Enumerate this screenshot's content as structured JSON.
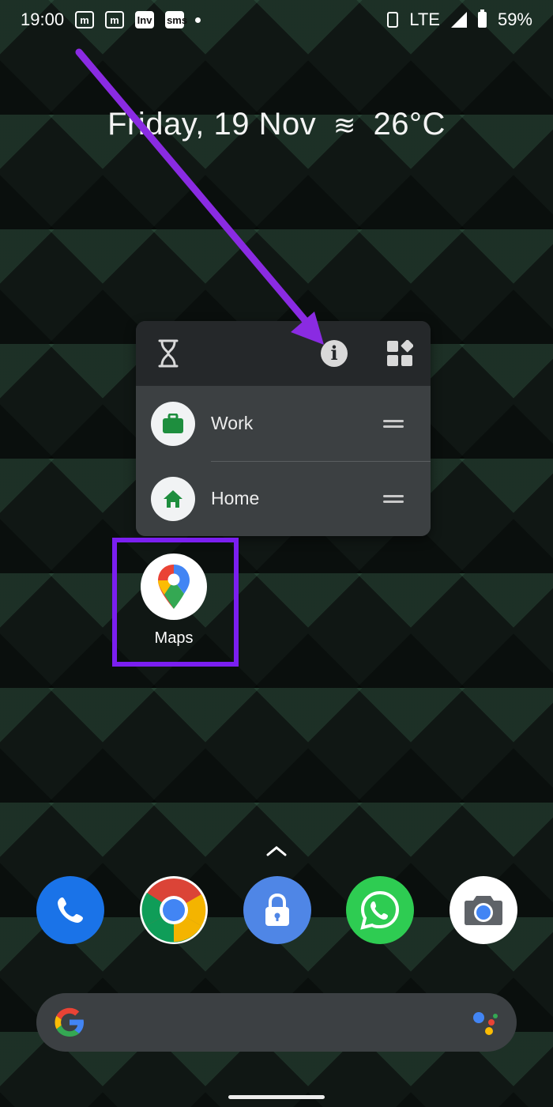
{
  "status_bar": {
    "time": "19:00",
    "notifications": [
      "m",
      "m",
      "Inv",
      "sms"
    ],
    "network": "LTE",
    "battery": "59%"
  },
  "glance": {
    "date": "Friday, 19 Nov",
    "temperature": "26°C",
    "weather_icon": "haze-icon"
  },
  "popup": {
    "top_icons": [
      "hourglass-icon",
      "info-icon",
      "widgets-icon"
    ],
    "shortcuts": [
      {
        "label": "Work",
        "icon": "briefcase-icon"
      },
      {
        "label": "Home",
        "icon": "home-icon"
      }
    ]
  },
  "app": {
    "label": "Maps",
    "icon": "maps-pin-icon"
  },
  "dock": [
    "phone-icon",
    "chrome-icon",
    "lock-icon",
    "whatsapp-icon",
    "camera-icon"
  ],
  "search": {
    "logo": "G",
    "assistant_icon": "google-assistant-icon"
  },
  "colors": {
    "highlight": "#7b1ff0",
    "arrow": "#8a2be2",
    "shortcut_green": "#1e8e3e"
  }
}
